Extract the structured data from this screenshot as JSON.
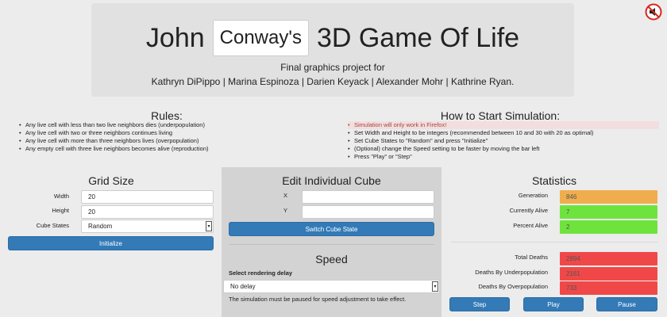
{
  "header": {
    "title_left": "John",
    "title_box": "Conway's",
    "title_right": "3D Game Of Life",
    "subtitle": "Final graphics project for",
    "credits": "Kathryn DiPippo | Marina Espinoza | Darien Keyack | Alexander Mohr | Kathrine Ryan."
  },
  "rules": {
    "title": "Rules:",
    "items": [
      "Any live cell with less than two live neighbors dies (underpopulation)",
      "Any live cell with two or three neighbors continues living",
      "Any live cell with more than three neighbors lives (overpopulation)",
      "Any empty cell with three live neighbors becomes alive (reproduction)"
    ]
  },
  "howto": {
    "title": "How to Start Simulation:",
    "items": [
      "Simulation will only work in Firefox!",
      "Set Width and Height to be integers (recommended between 10 and 30 with 20 as optimal)",
      "Set Cube States to \"Random\" and press \"Initialize\"",
      "(Optional) change the Speed setting to be faster by moving the bar left",
      "Press \"Play\" or \"Step\""
    ]
  },
  "grid": {
    "title": "Grid Size",
    "width_label": "Width",
    "width_value": "20",
    "height_label": "Height",
    "height_value": "20",
    "states_label": "Cube States",
    "states_value": "Random",
    "initialize_label": "Initialize"
  },
  "edit": {
    "title": "Edit Individual Cube",
    "x_label": "X",
    "x_value": "",
    "y_label": "Y",
    "y_value": "",
    "switch_label": "Switch Cube State"
  },
  "speed": {
    "title": "Speed",
    "delay_label": "Select rendering delay",
    "delay_value": "No delay",
    "note": "The simulation must be paused for speed adjustment to take effect."
  },
  "stats": {
    "title": "Statistics",
    "generation_label": "Generation",
    "generation_value": "846",
    "alive_label": "Currently Alive",
    "alive_value": "7",
    "percent_label": "Percent Alive",
    "percent_value": "2",
    "total_deaths_label": "Total Deaths",
    "total_deaths_value": "2894",
    "under_label": "Deaths By Underpopulation",
    "under_value": "2161",
    "over_label": "Deaths By Overpopulation",
    "over_value": "733"
  },
  "controls": {
    "step_label": "Step",
    "play_label": "Play",
    "pause_label": "Pause"
  },
  "colors": {
    "primary_button": "#337ab7",
    "stat_orange": "#f0ad4e",
    "stat_green": "#6fe33d",
    "stat_red": "#f04848",
    "warning_bg": "#f2dede"
  },
  "icons": {
    "mute": "speaker-muted-icon"
  }
}
